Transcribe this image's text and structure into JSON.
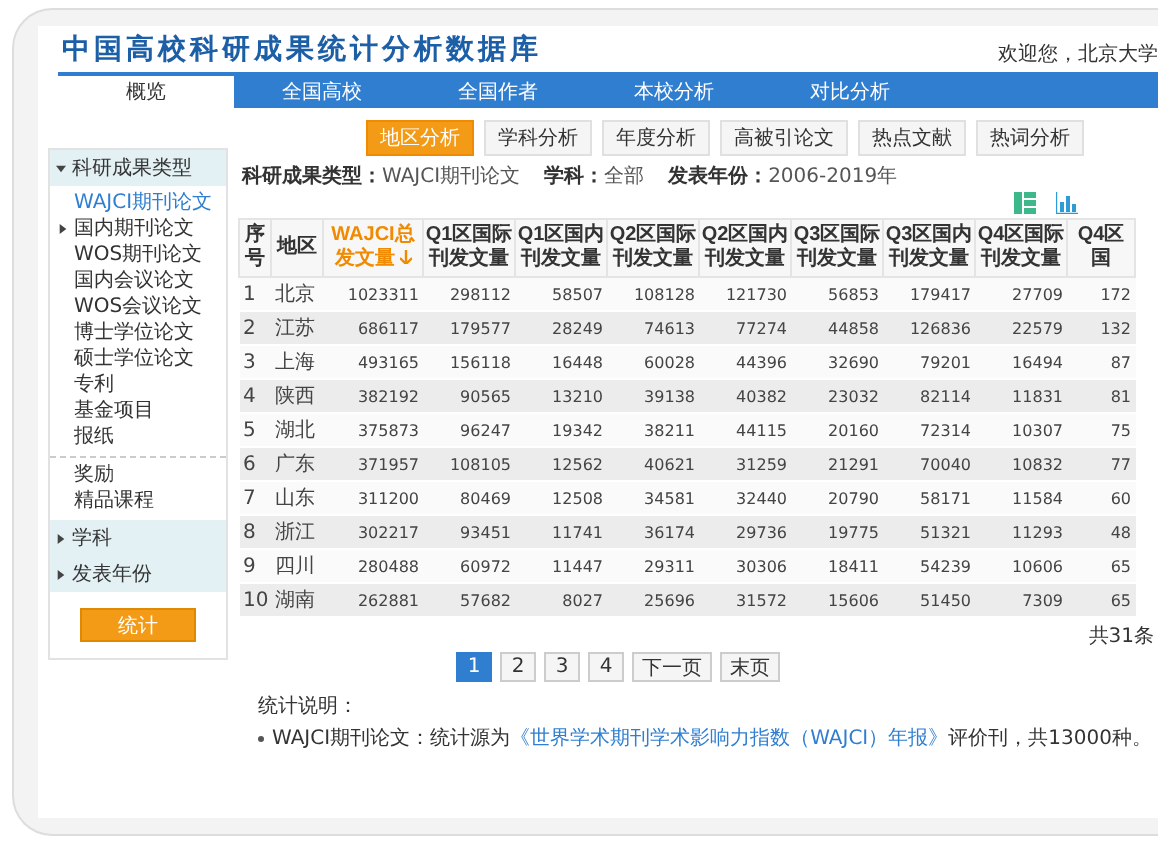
{
  "header": {
    "title": "中国高校科研成果统计分析数据库",
    "welcome": "欢迎您，北京大学"
  },
  "nav": [
    {
      "label": "概览",
      "selected": true
    },
    {
      "label": "全国高校",
      "selected": false
    },
    {
      "label": "全国作者",
      "selected": false
    },
    {
      "label": "本校分析",
      "selected": false
    },
    {
      "label": "对比分析",
      "selected": false
    }
  ],
  "sidebar": {
    "sections": [
      {
        "label": "科研成果类型",
        "expanded": true,
        "groups": [
          [
            {
              "label": "WAJCI期刊论文",
              "selected": true,
              "kind": "leaf"
            },
            {
              "label": "国内期刊论文",
              "selected": false,
              "kind": "branch"
            },
            {
              "label": "WOS期刊论文",
              "selected": false,
              "kind": "leaf"
            },
            {
              "label": "国内会议论文",
              "selected": false,
              "kind": "leaf"
            },
            {
              "label": "WOS会议论文",
              "selected": false,
              "kind": "leaf"
            },
            {
              "label": "博士学位论文",
              "selected": false,
              "kind": "leaf"
            },
            {
              "label": "硕士学位论文",
              "selected": false,
              "kind": "leaf"
            },
            {
              "label": "专利",
              "selected": false,
              "kind": "leaf"
            },
            {
              "label": "基金项目",
              "selected": false,
              "kind": "leaf"
            },
            {
              "label": "报纸",
              "selected": false,
              "kind": "leaf"
            }
          ],
          [
            {
              "label": "奖励",
              "selected": false,
              "kind": "leaf"
            },
            {
              "label": "精品课程",
              "selected": false,
              "kind": "leaf"
            }
          ]
        ]
      },
      {
        "label": "学科",
        "expanded": false
      },
      {
        "label": "发表年份",
        "expanded": false
      }
    ],
    "button": "统计"
  },
  "subtabs": [
    {
      "label": "地区分析",
      "selected": true
    },
    {
      "label": "学科分析",
      "selected": false
    },
    {
      "label": "年度分析",
      "selected": false
    },
    {
      "label": "高被引论文",
      "selected": false
    },
    {
      "label": "热点文献",
      "selected": false
    },
    {
      "label": "热词分析",
      "selected": false
    }
  ],
  "filters": [
    {
      "label": "科研成果类型：",
      "value": "WAJCI期刊论文"
    },
    {
      "label": "学科：",
      "value": "全部"
    },
    {
      "label": "发表年份：",
      "value": "2006-2019年"
    }
  ],
  "table": {
    "columns": [
      {
        "label": "序号",
        "sorted": false
      },
      {
        "label": "地区",
        "sorted": false
      },
      {
        "label": "WAJCI总发文量",
        "sorted": true
      },
      {
        "label": "Q1区国际刊发文量",
        "sorted": false
      },
      {
        "label": "Q1区国内刊发文量",
        "sorted": false
      },
      {
        "label": "Q2区国际刊发文量",
        "sorted": false
      },
      {
        "label": "Q2区国内刊发文量",
        "sorted": false
      },
      {
        "label": "Q3区国际刊发文量",
        "sorted": false
      },
      {
        "label": "Q3区国内刊发文量",
        "sorted": false
      },
      {
        "label": "Q4区国际刊发文量",
        "sorted": false
      },
      {
        "label": "Q4区国",
        "sorted": false
      }
    ],
    "rows": [
      [
        "1",
        "北京",
        "1023311",
        "298112",
        "58507",
        "108128",
        "121730",
        "56853",
        "179417",
        "27709",
        "172"
      ],
      [
        "2",
        "江苏",
        "686117",
        "179577",
        "28249",
        "74613",
        "77274",
        "44858",
        "126836",
        "22579",
        "132"
      ],
      [
        "3",
        "上海",
        "493165",
        "156118",
        "16448",
        "60028",
        "44396",
        "32690",
        "79201",
        "16494",
        "87"
      ],
      [
        "4",
        "陕西",
        "382192",
        "90565",
        "13210",
        "39138",
        "40382",
        "23032",
        "82114",
        "11831",
        "81"
      ],
      [
        "5",
        "湖北",
        "375873",
        "96247",
        "19342",
        "38211",
        "44115",
        "20160",
        "72314",
        "10307",
        "75"
      ],
      [
        "6",
        "广东",
        "371957",
        "108105",
        "12562",
        "40621",
        "31259",
        "21291",
        "70040",
        "10832",
        "77"
      ],
      [
        "7",
        "山东",
        "311200",
        "80469",
        "12508",
        "34581",
        "32440",
        "20790",
        "58171",
        "11584",
        "60"
      ],
      [
        "8",
        "浙江",
        "302217",
        "93451",
        "11741",
        "36174",
        "29736",
        "19775",
        "51321",
        "11293",
        "48"
      ],
      [
        "9",
        "四川",
        "280488",
        "60972",
        "11447",
        "29311",
        "30306",
        "18411",
        "54239",
        "10606",
        "65"
      ],
      [
        "10",
        "湖南",
        "262881",
        "57682",
        "8027",
        "25696",
        "31572",
        "15606",
        "51450",
        "7309",
        "65"
      ]
    ],
    "total": "共31条"
  },
  "pagination": [
    {
      "label": "1",
      "selected": true
    },
    {
      "label": "2",
      "selected": false
    },
    {
      "label": "3",
      "selected": false
    },
    {
      "label": "4",
      "selected": false
    },
    {
      "label": "下一页",
      "selected": false
    },
    {
      "label": "末页",
      "selected": false
    }
  ],
  "notes": {
    "title": "统计说明：",
    "items": [
      {
        "prefix": "WAJCI期刊论文：统计源为",
        "link": "《世界学术期刊学术影响力指数（WAJCI）年报》",
        "suffix": "评价刊，共13000种。"
      }
    ]
  }
}
